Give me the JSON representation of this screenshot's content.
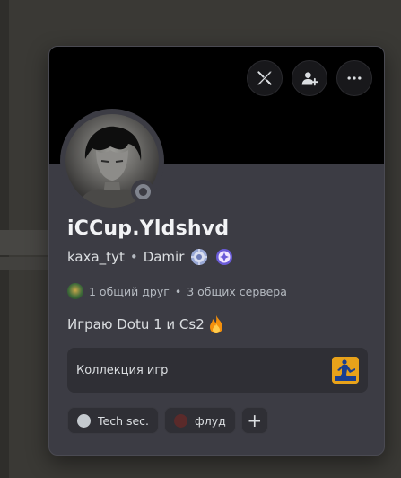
{
  "profile": {
    "display_name": "iCCup.Yldshvd",
    "username": "kaxa_tyt",
    "separator": "•",
    "pronoun_name": "Damir",
    "status": "offline",
    "status_color": "#80848e"
  },
  "actions": {
    "block_icon": "swords-crossed-icon",
    "add_friend_icon": "add-friend-icon",
    "more_icon": "more-horizontal-icon"
  },
  "mutual": {
    "friends": "1 общий друг",
    "separator": "•",
    "servers": "3 общих сервера"
  },
  "bio": {
    "text": "Играю Dotu 1 и Cs2",
    "emoji": "fire-emoji"
  },
  "collection": {
    "label": "Коллекция игр",
    "game_icon": "counter-strike-icon"
  },
  "roles": [
    {
      "name": "Tech sec.",
      "color": "#c4c9ce"
    },
    {
      "name": "флуд",
      "color": "#5a2a2a"
    }
  ],
  "add_role_label": "+",
  "colors": {
    "card_bg": "#3c3c44",
    "banner": "#000000",
    "accent_text": "#f2f3f5"
  }
}
